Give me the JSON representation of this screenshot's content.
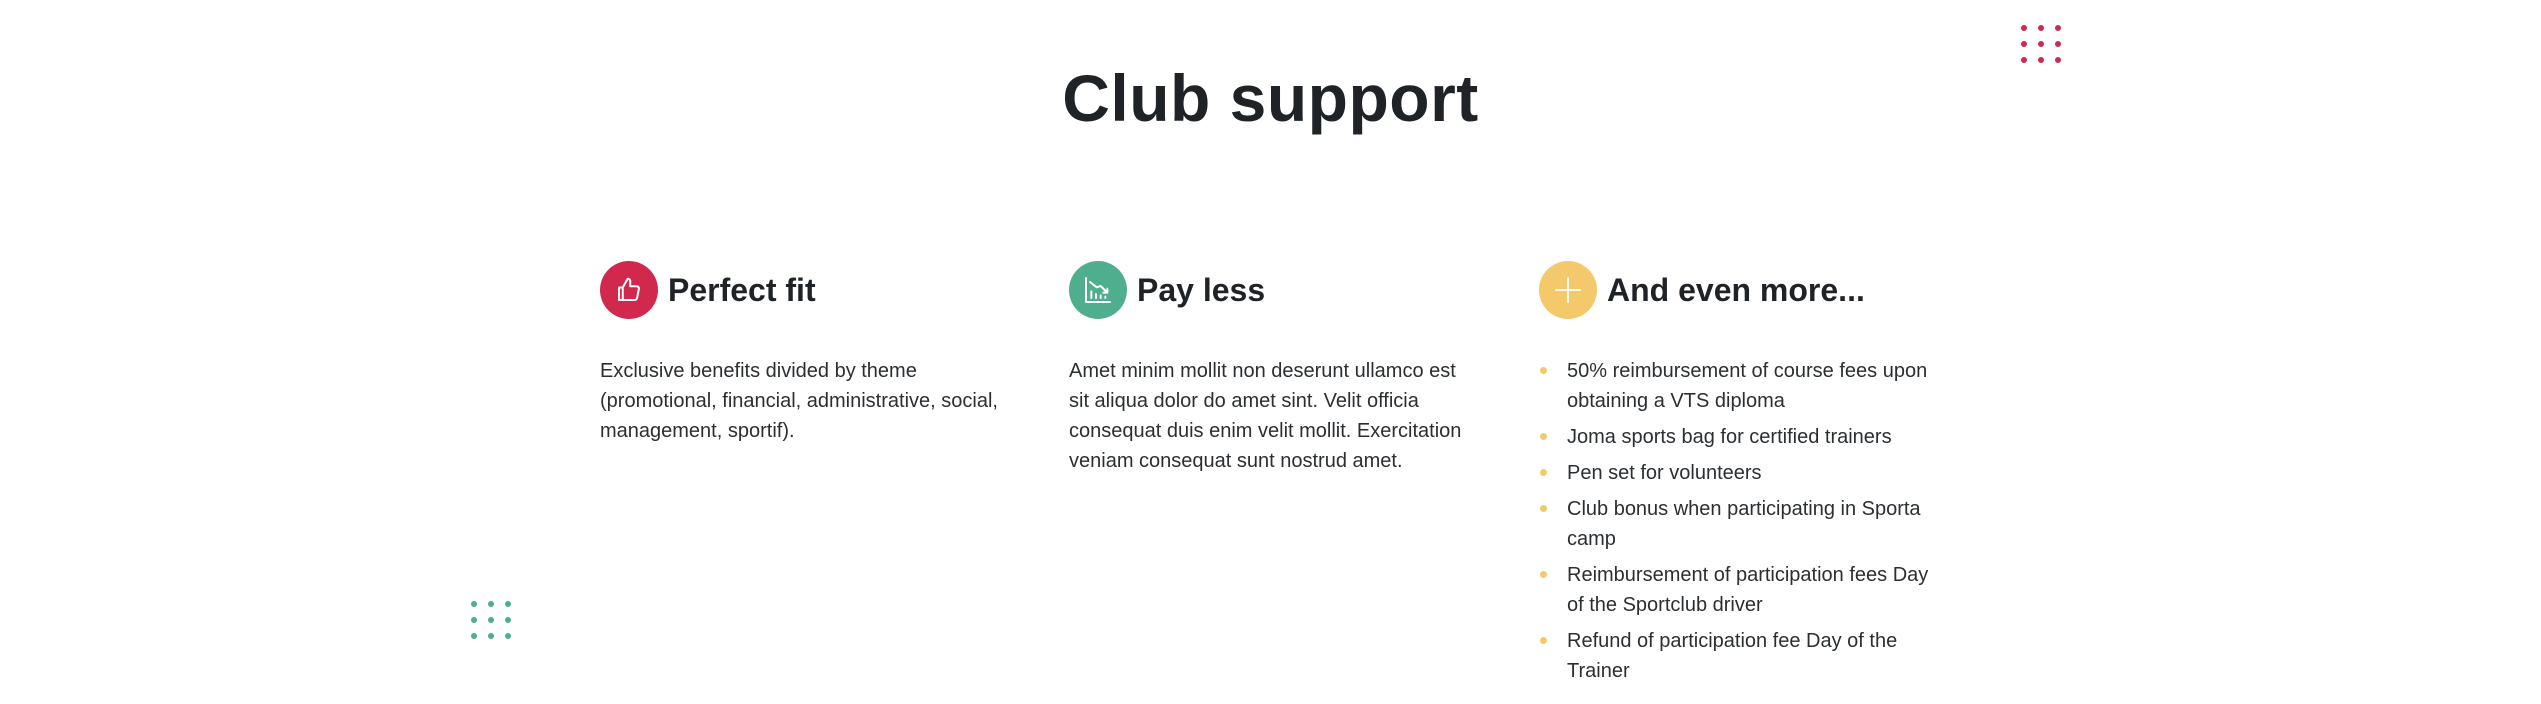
{
  "page": {
    "title": "Club support"
  },
  "colors": {
    "red": "#d0294d",
    "green": "#4fae8e",
    "yellow": "#f4c96b",
    "text": "#1f2328"
  },
  "columns": [
    {
      "title": "Perfect fit",
      "icon": "thumbs-up-icon",
      "text": "Exclusive benefits divided by theme (promotional, financial, administrative, social, management, sportif)."
    },
    {
      "title": "Pay less",
      "icon": "declining-chart-icon",
      "text": "Amet minim mollit non deserunt ullamco est sit aliqua dolor do amet sint. Velit officia consequat duis enim velit mollit. Exercitation veniam consequat sunt nostrud amet."
    },
    {
      "title": "And even more...",
      "icon": "plus-icon",
      "items": [
        "50% reimbursement of course fees upon obtaining a VTS diploma",
        "Joma sports bag for certified trainers",
        "Pen set for volunteers",
        "Club bonus when participating in Sporta camp",
        "Reimbursement of participation fees Day of the Sportclub driver",
        "Refund of participation fee Day of the Trainer"
      ]
    }
  ]
}
